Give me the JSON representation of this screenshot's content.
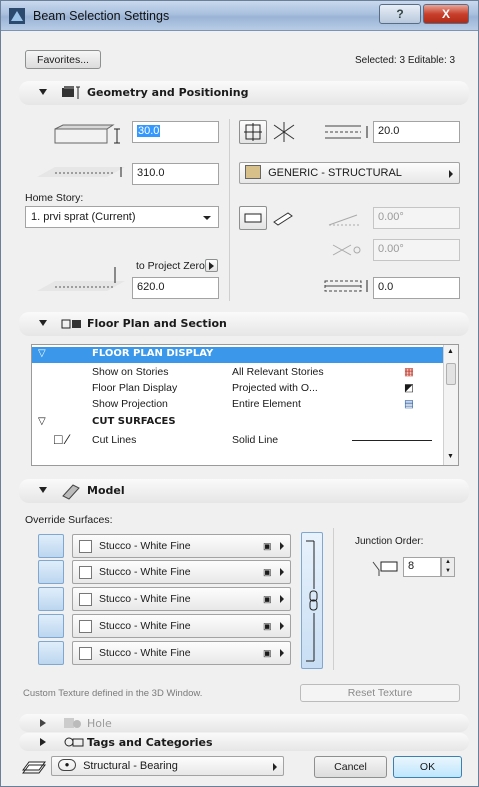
{
  "window": {
    "title": "Beam Selection Settings",
    "help_label": "?",
    "close_label": "X"
  },
  "top": {
    "favorites_label": "Favorites...",
    "selection_info": "Selected: 3 Editable: 3"
  },
  "geometry": {
    "title": "Geometry and Positioning",
    "height_value": "30.0",
    "width_value": "310.0",
    "offset_value": "20.0",
    "home_story_label": "Home Story:",
    "home_story_value": "1. prvi sprat (Current)",
    "to_project_zero_label": "to Project Zero",
    "project_zero_value": "620.0",
    "structure_value": "GENERIC - STRUCTURAL",
    "slant_angle_value": "0.00°",
    "rotation_value": "0.00°",
    "ref_offset_value": "0.0"
  },
  "floor_plan": {
    "title": "Floor Plan and Section",
    "rows": [
      {
        "type": "group",
        "label": "FLOOR PLAN DISPLAY",
        "value": ""
      },
      {
        "type": "item",
        "label": "Show on Stories",
        "value": "All Relevant Stories"
      },
      {
        "type": "item",
        "label": "Floor Plan Display",
        "value": "Projected with O..."
      },
      {
        "type": "item",
        "label": "Show Projection",
        "value": "Entire Element"
      },
      {
        "type": "group",
        "label": "CUT SURFACES",
        "value": ""
      },
      {
        "type": "item",
        "label": "Cut Lines",
        "value": "Solid Line"
      }
    ]
  },
  "model": {
    "title": "Model",
    "override_label": "Override Surfaces:",
    "surfaces": [
      {
        "label": "Stucco - White Fine"
      },
      {
        "label": "Stucco - White Fine"
      },
      {
        "label": "Stucco - White Fine"
      },
      {
        "label": "Stucco - White Fine"
      },
      {
        "label": "Stucco - White Fine"
      }
    ],
    "junction_label": "Junction Order:",
    "junction_value": "8",
    "custom_texture_note": "Custom Texture defined in the 3D Window.",
    "reset_texture_label": "Reset Texture"
  },
  "collapsed_sections": {
    "hole": "Hole",
    "tags": "Tags and Categories"
  },
  "bottom": {
    "layer_value": "Structural - Bearing",
    "cancel_label": "Cancel",
    "ok_label": "OK"
  },
  "colors": {
    "selection_blue": "#3a97e9",
    "title_bar": "#a9c0de",
    "close_red": "#c8402c"
  },
  "icons": [
    "beam-app-icon",
    "help-icon",
    "close-icon",
    "beam-geometry-icon",
    "floor-plan-icon",
    "model-icon",
    "hole-icon",
    "tags-icon",
    "layer-icon",
    "eye-icon",
    "link-chain-icon"
  ]
}
